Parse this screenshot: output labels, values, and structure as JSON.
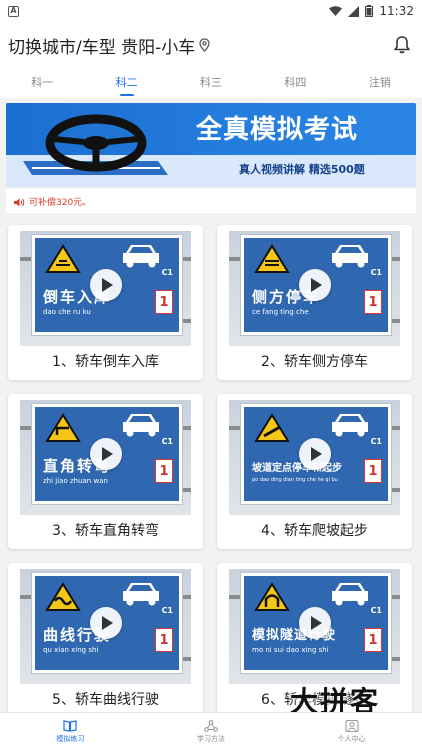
{
  "status_bar": {
    "time": "11:32",
    "app_indicator": "A"
  },
  "header": {
    "title": "切换城市/车型 贵阳-小车",
    "location_icon": "location-pin-icon",
    "bell_icon": "bell-icon"
  },
  "tabs": [
    {
      "label": "科一",
      "active": false
    },
    {
      "label": "科二",
      "active": true
    },
    {
      "label": "科三",
      "active": false
    },
    {
      "label": "科四",
      "active": false
    },
    {
      "label": "注销",
      "active": false
    }
  ],
  "banner": {
    "headline": "全真模拟考试",
    "subline": "真人视频讲解  精选500题"
  },
  "subsidy": {
    "text": "可补偿320元。"
  },
  "cards": [
    {
      "caption": "1、轿车倒车入库",
      "sign_text": "倒车入库",
      "pinyin": "dao che ru ku",
      "class_label": "C1",
      "badge": "1"
    },
    {
      "caption": "2、轿车侧方停车",
      "sign_text": "侧方停车",
      "pinyin": "ce fang ting che",
      "class_label": "C1",
      "badge": "1"
    },
    {
      "caption": "3、轿车直角转弯",
      "sign_text": "直角转弯",
      "pinyin": "zhi jiao zhuan wan",
      "class_label": "C1",
      "badge": "1"
    },
    {
      "caption": "4、轿车爬坡起步",
      "sign_text": "坡道定点停车和起步",
      "pinyin": "po dao ding dian ting che he qi bu",
      "class_label": "C1",
      "badge": "1"
    },
    {
      "caption": "5、轿车曲线行驶",
      "sign_text": "曲线行驶",
      "pinyin": "qu xian xing shi",
      "class_label": "C1",
      "badge": "1"
    },
    {
      "caption": "6、轿车模拟隧道",
      "sign_text": "模拟隧道行驶",
      "pinyin": "mo ni sui dao xing shi",
      "class_label": "C1",
      "badge": "1"
    }
  ],
  "bottom_nav": [
    {
      "label": "模拟练习",
      "icon": "book-icon",
      "active": true
    },
    {
      "label": "学习方法",
      "icon": "method-icon",
      "active": false
    },
    {
      "label": "个人中心",
      "icon": "user-icon",
      "active": false
    }
  ],
  "watermark": "大拼客",
  "colors": {
    "accent": "#1a73e8",
    "banner": "#1f78d8",
    "sign_blue": "#2f68b0",
    "warning_red": "#d83a2a"
  }
}
